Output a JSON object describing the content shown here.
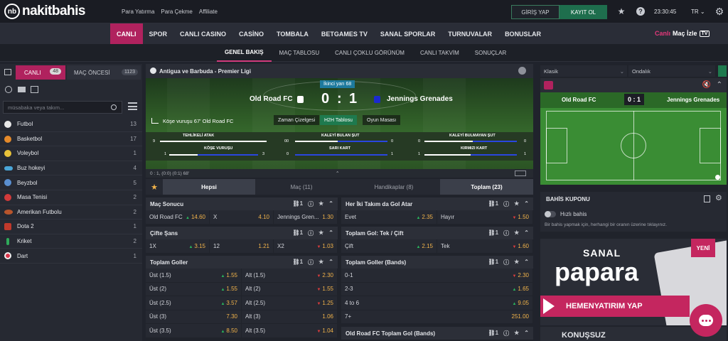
{
  "brand": {
    "logo_mark": "nb",
    "name": "nakitbahis"
  },
  "top_links": [
    "Para Yatırma",
    "Para Çekme",
    "Affiliate"
  ],
  "auth": {
    "login": "GİRİŞ YAP",
    "register": "KAYIT OL"
  },
  "clock": "23:30:45",
  "lang": "TR ⌄",
  "main_nav": [
    "CANLI",
    "SPOR",
    "CANLI CASINO",
    "CASİNO",
    "TOMBALA",
    "BETGAMES TV",
    "SANAL SPORLAR",
    "TURNUVALAR",
    "BONUSLAR"
  ],
  "canli_tv": {
    "a": "Canlı",
    "b": "Maç İzle",
    "tv": "TV"
  },
  "sub_nav": [
    "GENEL BAKIŞ",
    "MAÇ TABLOSU",
    "CANLI ÇOKLU GÖRÜNÜM",
    "CANLI TAKVİM",
    "SONUÇLAR"
  ],
  "left": {
    "tab_live": "CANLI",
    "live_count": "48",
    "tab_pre": "MAÇ ÖNCESİ",
    "pre_count": "1123",
    "search_placeholder": "müsabaka veya takım...",
    "sports": [
      {
        "name": "Futbol",
        "count": "13",
        "color": "#e8e8e8"
      },
      {
        "name": "Basketbol",
        "count": "17",
        "color": "#e58a2a"
      },
      {
        "name": "Voleybol",
        "count": "1",
        "color": "#e8c23a"
      },
      {
        "name": "Buz hokeyi",
        "count": "4",
        "color": "#4aa6d8"
      },
      {
        "name": "Beyzbol",
        "count": "5",
        "color": "#5a8fd0"
      },
      {
        "name": "Masa Tenisi",
        "count": "2",
        "color": "#d23a3a"
      },
      {
        "name": "Amerikan Futbolu",
        "count": "2",
        "color": "#b8552c"
      },
      {
        "name": "Dota 2",
        "count": "1",
        "color": "#c0392b"
      },
      {
        "name": "Kriket",
        "count": "2",
        "color": "#2faa5a"
      },
      {
        "name": "Dart",
        "count": "1",
        "color": "#d9334a"
      }
    ]
  },
  "match": {
    "league": "Antigua ve Barbuda - Premier Ligi",
    "status": "İkinci yarı 68",
    "home": "Old Road FC",
    "away": "Jennings Grenades",
    "home_score": "0",
    "sep": ":",
    "away_score": "1",
    "event": "Köşe vuruşu 67' Old Road FC",
    "tabs": [
      "Zaman Çizelgesi",
      "H2H Tablosu",
      "Oyun Masası"
    ],
    "stats": [
      {
        "label": "TEHLİKELİ ATAK",
        "home": "9",
        "away": "0"
      },
      {
        "label": "KALEYİ BULAN ŞUT",
        "home": "0",
        "away": "0"
      },
      {
        "label": "KALEYİ BULMAYAN ŞUT",
        "home": "0",
        "away": "0"
      },
      {
        "label": "KÖŞE VURUŞU",
        "home": "1",
        "away": "3"
      },
      {
        "label": "SARI KART",
        "home": "0",
        "away": "1"
      },
      {
        "label": "KIRMIZI KART",
        "home": "1",
        "away": "1"
      }
    ],
    "scoreline": "0 : 1, (0:0) (0:1) 68'"
  },
  "market_tabs": [
    "Hepsi",
    "Maç (11)",
    "Handikaplar (8)",
    "Toplam (23)"
  ],
  "markets": {
    "mac_sonucu": {
      "title": "Maç Sonucu",
      "rows": [
        [
          [
            "Old Road FC",
            "14.60"
          ],
          [
            "X",
            "4.10"
          ],
          [
            "Jennings Gren...",
            "1.30"
          ]
        ]
      ]
    },
    "cifte_sans": {
      "title": "Çifte Şans",
      "rows": [
        [
          [
            "1X",
            "3.15"
          ],
          [
            "12",
            "1.21"
          ],
          [
            "X2",
            "1.03"
          ]
        ]
      ]
    },
    "toplam_goller": {
      "title": "Toplam Goller",
      "rows": [
        [
          [
            "Üst (1.5)",
            "1.55"
          ],
          [
            "Alt (1.5)",
            "2.30"
          ]
        ],
        [
          [
            "Üst (2)",
            "1.55"
          ],
          [
            "Alt (2)",
            "1.55"
          ]
        ],
        [
          [
            "Üst (2.5)",
            "3.57"
          ],
          [
            "Alt (2.5)",
            "1.25"
          ]
        ],
        [
          [
            "Üst (3)",
            "7.30"
          ],
          [
            "Alt (3)",
            "1.06"
          ]
        ],
        [
          [
            "Üst (3.5)",
            "8.50"
          ],
          [
            "Alt (3.5)",
            "1.04"
          ]
        ]
      ]
    },
    "her_iki": {
      "title": "Her İki Takım da Gol Atar",
      "rows": [
        [
          [
            "Evet",
            "2.35"
          ],
          [
            "Hayır",
            "1.50"
          ]
        ]
      ]
    },
    "tek_cift": {
      "title": "Toplam Gol: Tek / Çift",
      "rows": [
        [
          [
            "Çift",
            "2.15"
          ],
          [
            "Tek",
            "1.60"
          ]
        ]
      ]
    },
    "bands": {
      "title": "Toplam Goller (Bands)",
      "rows": [
        [
          "0-1",
          "2.30"
        ],
        [
          "2-3",
          "1.65"
        ],
        [
          "4 to 6",
          "9.05"
        ],
        [
          "7+",
          "251.00"
        ]
      ]
    },
    "home_bands": {
      "title": "Old Road FC Toplam Gol (Bands)"
    },
    "badge": "1"
  },
  "right": {
    "sel1": "Klasik",
    "sel2": "Ondalık",
    "mini_home": "Old Road FC",
    "mini_score": "0 : 1",
    "mini_away": "Jennings Grenades",
    "coupon_title": "BAHİS KUPONU",
    "quick_bet": "Hızlı bahis",
    "coupon_hint": "Bir bahis yapmak için, herhangi bir oranın üzerine tıklayınız.",
    "promo_top": "SANAL",
    "promo_brand": "papara",
    "promo_badge": "YENİ",
    "promo_cta_a": "HEMEN ",
    "promo_cta_b": "YATIRIM YAP",
    "promo2": "KONUŞSUZ"
  }
}
